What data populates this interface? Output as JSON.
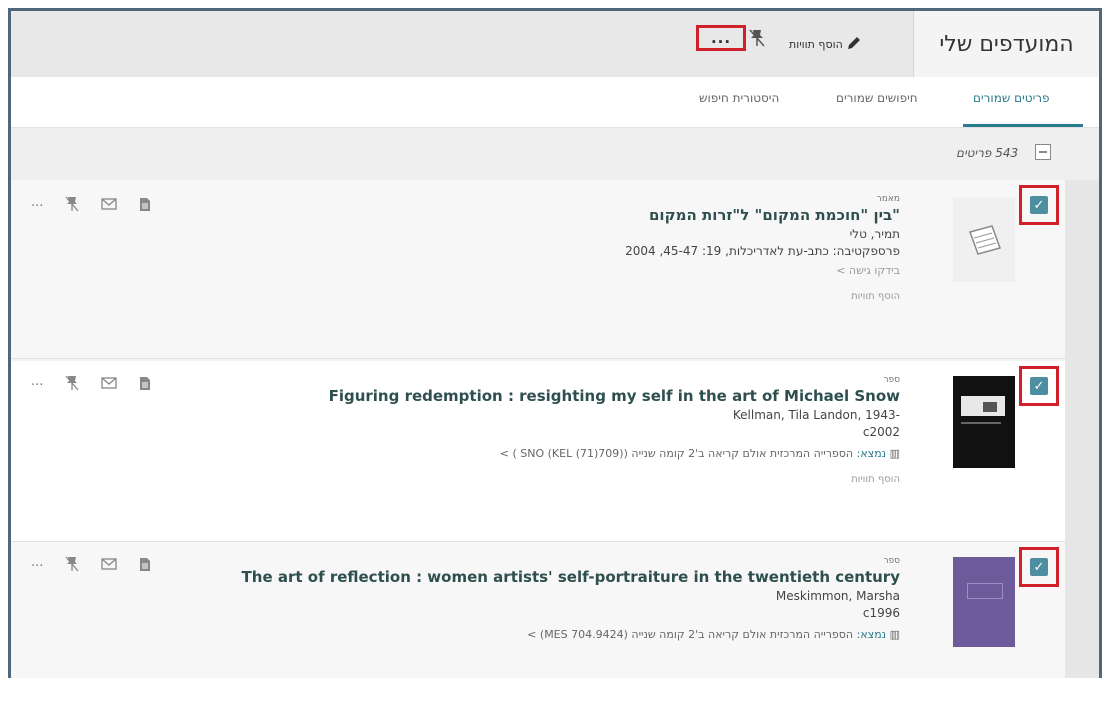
{
  "header": {
    "title": "המועדפים שלי",
    "add_labels": "הוסף תוויות",
    "pin_icon": "pin-off-icon",
    "more": "..."
  },
  "tabs": [
    {
      "label": "פריטים שמורים",
      "active": true
    },
    {
      "label": "חיפושים שמורים",
      "active": false
    },
    {
      "label": "היסטורית חיפוש",
      "active": false
    }
  ],
  "count": {
    "number": "543",
    "word": "פריטים",
    "full": "543 פריטים"
  },
  "items": [
    {
      "type": "מאמר",
      "title": "\"בין \"חוכמת המקום\" ל\"זרות המקום",
      "author": "תמיר, טלי",
      "source": "פרספקטיבה: כתב-עת לאדריכלות, 19: 45-47, 2004",
      "access": "בידקו גישה >",
      "add_labels": "הוסף תוויות"
    },
    {
      "type": "ספר",
      "title": "Figuring redemption : resighting my self in the art of Michael Snow",
      "author": "Kellman, Tila Landon, 1943-",
      "date": "c2002",
      "location_found": "נמצא:",
      "location": "הספרייה המרכזית  אולם קריאה ב'2 קומה שנייה  (SNO (KEL (71)709) ) >",
      "add_labels": "הוסף תוויות"
    },
    {
      "type": "ספר",
      "title": "The art of reflection : women artists' self-portraiture in the twentieth century",
      "author": "Meskimmon, Marsha",
      "date": "c1996",
      "location_found": "נמצא:",
      "location": "הספרייה המרכזית  אולם קריאה ב'2 קומה שנייה  (MES 704.9424) >"
    }
  ],
  "actions": {
    "more": "···",
    "pin": "pin-off-icon",
    "email": "envelope-icon",
    "cite": "document-icon"
  },
  "colors": {
    "accent": "#2a7b8e",
    "highlight": "#d0202a",
    "checkbox": "#4d8fa0"
  }
}
